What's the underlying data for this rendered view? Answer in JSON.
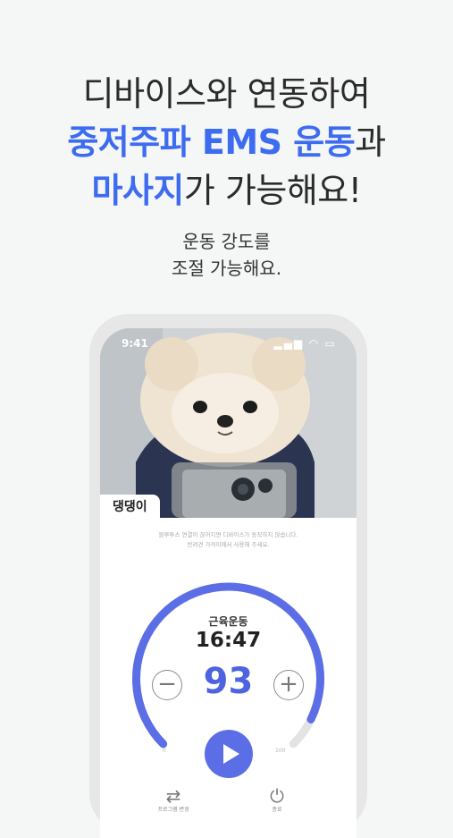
{
  "headline": {
    "line1": "디바이스와 연동하여",
    "line2_accent": "중저주파 EMS 운동",
    "line2_rest": "과",
    "line3_accent": "마사지",
    "line3_rest": "가 가능해요!"
  },
  "subheadline": {
    "line1": "운동 강도를",
    "line2": "조절 가능해요."
  },
  "phone": {
    "status_time": "9:41",
    "status_icons": "▂▄▆ ◠ ▭",
    "device_name": "댕댕이",
    "notice_line1": "블루투스 연결이 끊어지면 디바이스가 동작하지 않습니다.",
    "notice_line2": "반려견 가까이에서 사용해 주세요.",
    "mode_label": "근육운동",
    "timer": "16:47",
    "intensity": "93",
    "intensity_fraction": 0.93,
    "minus_icon": "minus-circle",
    "plus_icon": "plus-circle",
    "min_tick": "0",
    "max_tick": "100",
    "footer_left_label": "프로그램 변경",
    "footer_right_label": "종료",
    "colors": {
      "accent": "#3d6cf0",
      "gauge": "#5b6ee6",
      "track": "#e3e3e3"
    }
  }
}
